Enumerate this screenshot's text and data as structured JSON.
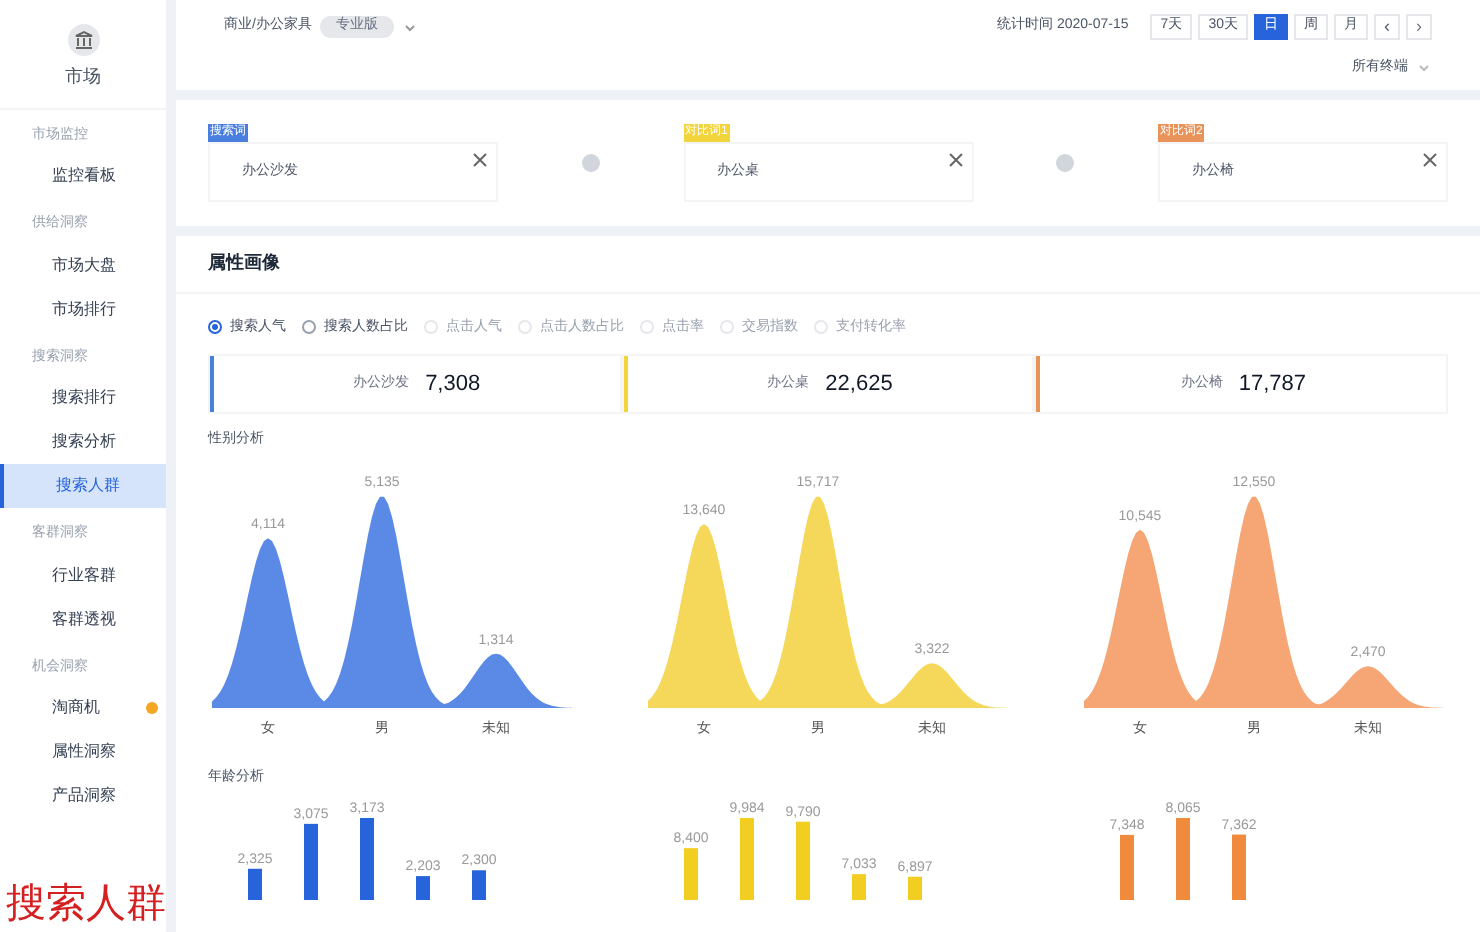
{
  "sidebar": {
    "title": "市场",
    "groups": [
      {
        "label": "市场监控",
        "items": [
          {
            "label": "监控看板",
            "selected": false
          }
        ]
      },
      {
        "label": "供给洞察",
        "items": [
          {
            "label": "市场大盘",
            "selected": false
          },
          {
            "label": "市场排行",
            "selected": false
          }
        ]
      },
      {
        "label": "搜索洞察",
        "items": [
          {
            "label": "搜索排行",
            "selected": false
          },
          {
            "label": "搜索分析",
            "selected": false
          },
          {
            "label": "搜索人群",
            "selected": true
          }
        ]
      },
      {
        "label": "客群洞察",
        "items": [
          {
            "label": "行业客群",
            "selected": false
          },
          {
            "label": "客群透视",
            "selected": false
          }
        ]
      },
      {
        "label": "机会洞察",
        "items": [
          {
            "label": "淘商机",
            "selected": false,
            "color": "#f5a623"
          },
          {
            "label": "属性洞察",
            "selected": false
          },
          {
            "label": "产品洞察",
            "selected": false
          }
        ]
      }
    ]
  },
  "header": {
    "category": "商业/办公家具",
    "badge": "专业版",
    "stat_time": "统计时间 2020-07-15",
    "ranges": [
      {
        "label": "7天",
        "selected": false
      },
      {
        "label": "30天",
        "selected": false
      },
      {
        "label": "日",
        "selected": true
      },
      {
        "label": "周",
        "selected": false
      },
      {
        "label": "月",
        "selected": false
      }
    ],
    "prev": "‹",
    "next": "›",
    "terminal": "所有终端"
  },
  "compare": [
    {
      "tag": "搜索词",
      "color": "#4a7fe0",
      "word": "办公沙发"
    },
    {
      "tag": "对比词1",
      "color": "#f2d43c",
      "word": "办公桌"
    },
    {
      "tag": "对比词2",
      "color": "#e8935a",
      "word": "办公椅"
    }
  ],
  "panel": {
    "title": "属性画像",
    "metrics": [
      {
        "label": "搜索人气",
        "selected": true,
        "disabled": false
      },
      {
        "label": "搜索人数占比",
        "selected": false,
        "disabled": false
      },
      {
        "label": "点击人气",
        "selected": false,
        "disabled": true
      },
      {
        "label": "点击人数占比",
        "selected": false,
        "disabled": true
      },
      {
        "label": "点击率",
        "selected": false,
        "disabled": true
      },
      {
        "label": "交易指数",
        "selected": false,
        "disabled": true
      },
      {
        "label": "支付转化率",
        "selected": false,
        "disabled": true
      }
    ],
    "totals": [
      {
        "word": "办公沙发",
        "value": "7,308",
        "color": "#4a7fe0"
      },
      {
        "word": "办公桌",
        "value": "22,625",
        "color": "#f2d43c"
      },
      {
        "word": "办公椅",
        "value": "17,787",
        "color": "#e8935a"
      }
    ],
    "gender_title": "性别分析",
    "gender_groups": [
      {
        "color": "#5b8ae6",
        "peaks": [
          {
            "label": "女",
            "value": "4,114"
          },
          {
            "label": "男",
            "value": "5,135"
          },
          {
            "label": "未知",
            "value": "1,314"
          }
        ]
      },
      {
        "color": "#f5d85a",
        "peaks": [
          {
            "label": "女",
            "value": "13,640"
          },
          {
            "label": "男",
            "value": "15,717"
          },
          {
            "label": "未知",
            "value": "3,322"
          }
        ]
      },
      {
        "color": "#f6a574",
        "peaks": [
          {
            "label": "女",
            "value": "10,545"
          },
          {
            "label": "男",
            "value": "12,550"
          },
          {
            "label": "未知",
            "value": "2,470"
          }
        ]
      }
    ],
    "age_title": "年龄分析",
    "age_groups": [
      {
        "color": "#2763db",
        "bars": [
          "2,325",
          "3,075",
          "3,173",
          "2,203",
          "2,300"
        ]
      },
      {
        "color": "#f2cd22",
        "bars": [
          "8,400",
          "9,984",
          "9,790",
          "7,033",
          "6,897"
        ]
      },
      {
        "color": "#f08a3c",
        "bars": [
          "7,348",
          "8,065",
          "7,362"
        ]
      }
    ]
  },
  "caption": "搜索人群"
}
